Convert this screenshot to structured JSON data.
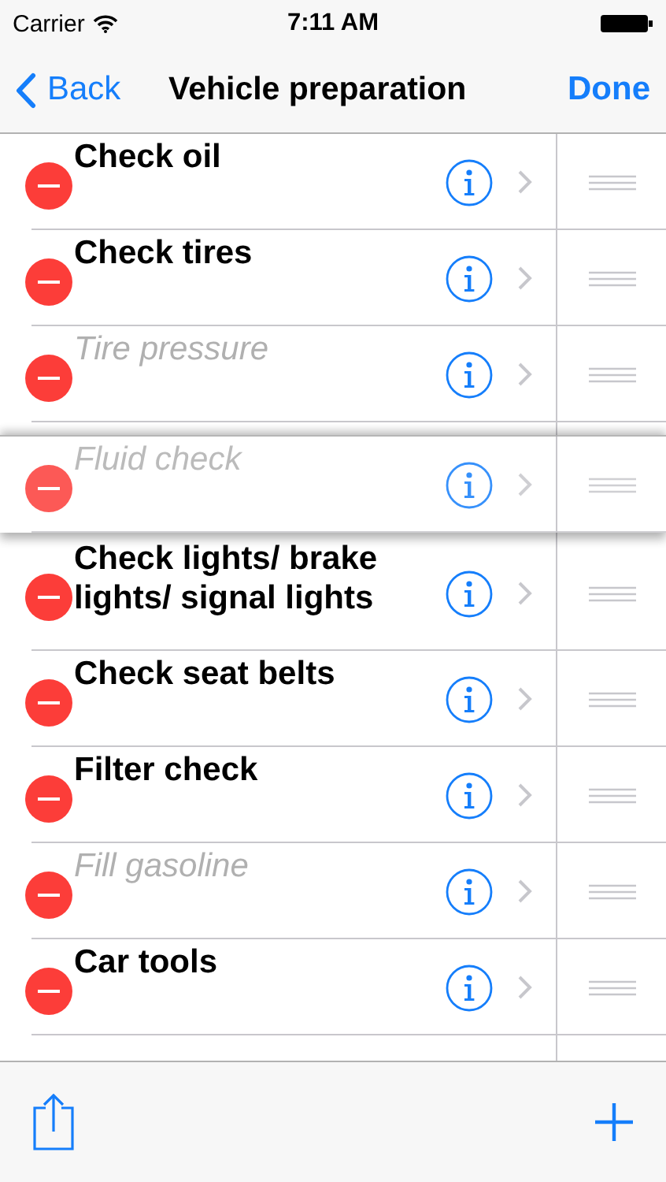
{
  "status_bar": {
    "carrier": "Carrier",
    "time": "7:11 AM"
  },
  "nav_bar": {
    "back": "Back",
    "title": "Vehicle preparation",
    "done": "Done"
  },
  "rows": [
    {
      "title": "Check oil",
      "completed": false,
      "dragging": false
    },
    {
      "title": "Check tires",
      "completed": false,
      "dragging": false
    },
    {
      "title": "Tire pressure",
      "completed": true,
      "dragging": false
    },
    {
      "title": "Fluid check",
      "completed": true,
      "dragging": true
    },
    {
      "title": "Check lights/ brake lights/ signal lights",
      "completed": false,
      "dragging": false
    },
    {
      "title": "Check seat belts",
      "completed": false,
      "dragging": false
    },
    {
      "title": "Filter check",
      "completed": false,
      "dragging": false
    },
    {
      "title": "Fill gasoline",
      "completed": true,
      "dragging": false
    },
    {
      "title": "Car tools",
      "completed": false,
      "dragging": false
    }
  ]
}
